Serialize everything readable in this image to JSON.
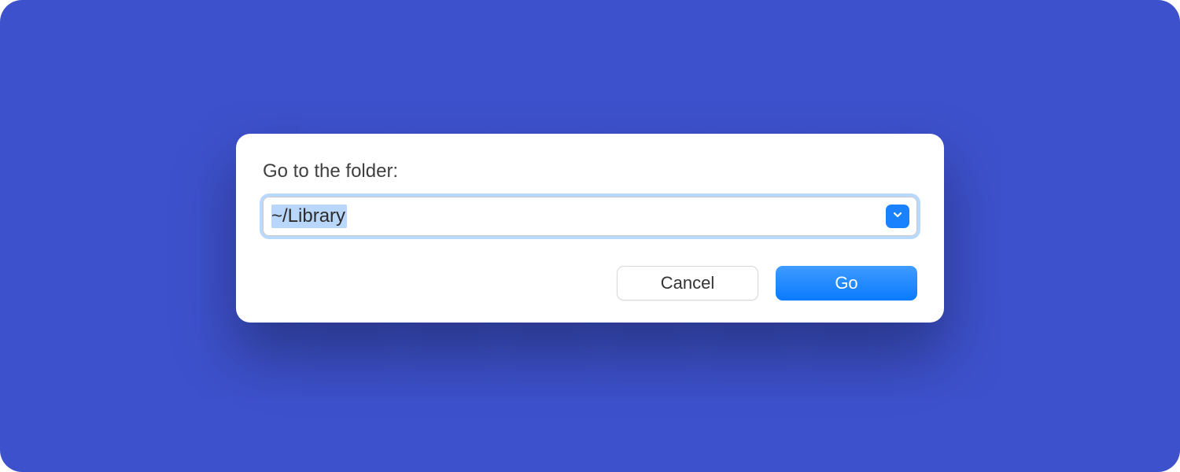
{
  "dialog": {
    "label": "Go to the folder:",
    "input_value": "~/Library",
    "dropdown_icon": "chevron-down",
    "buttons": {
      "cancel": "Cancel",
      "go": "Go"
    }
  }
}
